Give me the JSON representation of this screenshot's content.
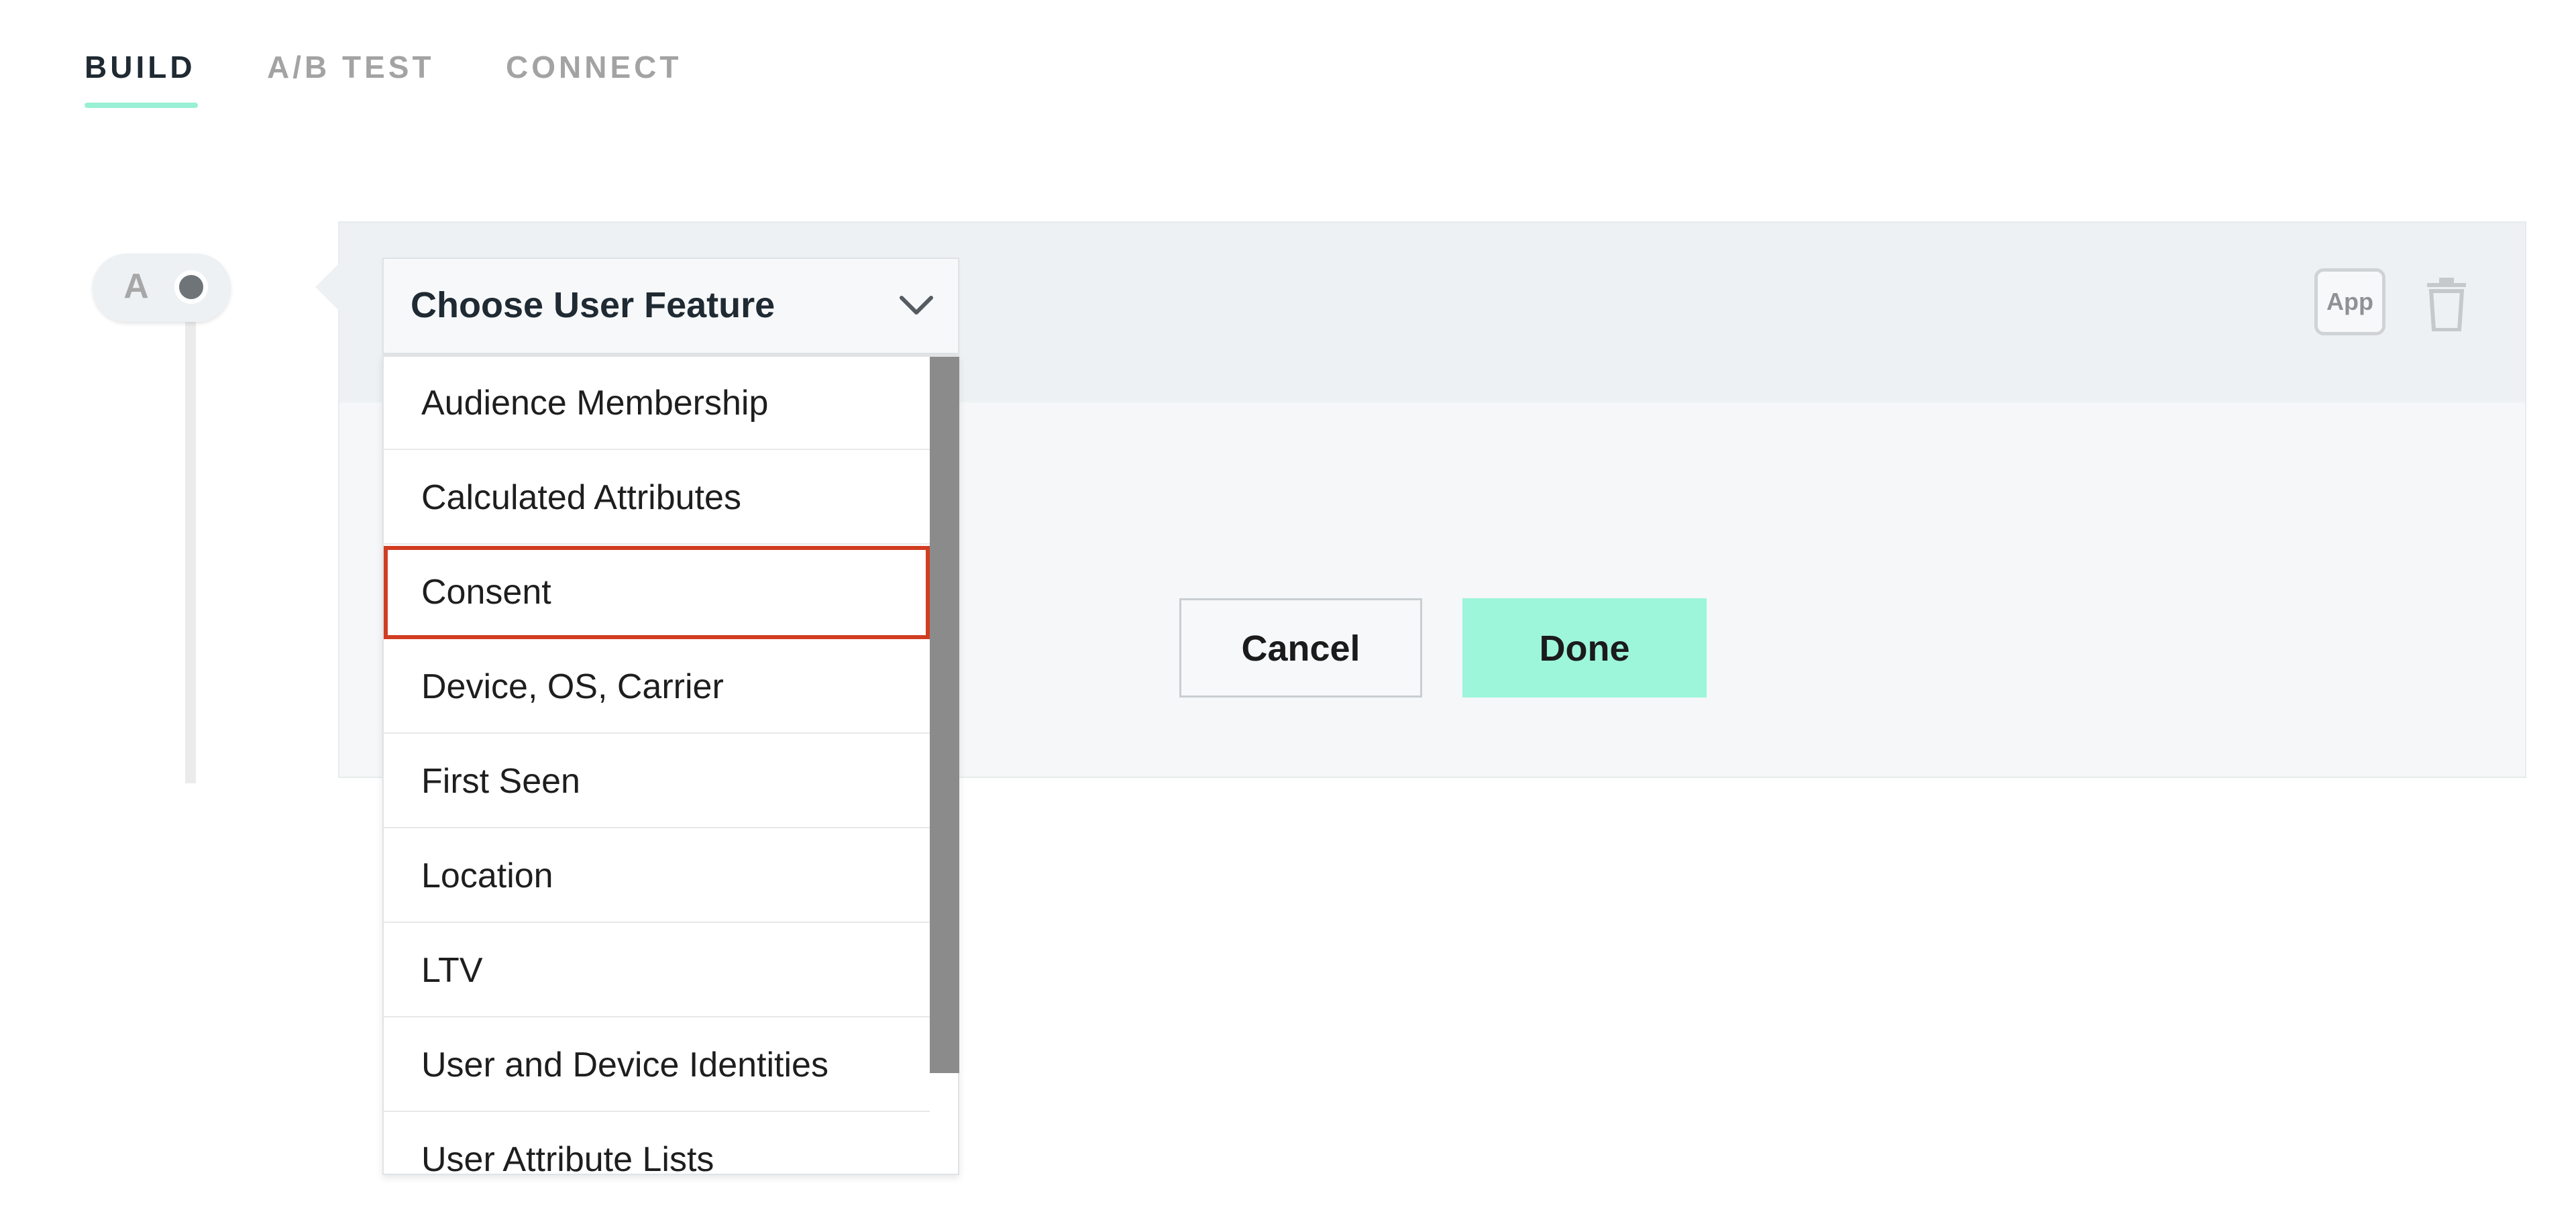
{
  "tabs": [
    {
      "label": "BUILD",
      "active": true
    },
    {
      "label": "A/B TEST",
      "active": false
    },
    {
      "label": "CONNECT",
      "active": false
    }
  ],
  "variant": {
    "letter": "A"
  },
  "card": {
    "app_label": "App",
    "delete_icon": "trash-icon"
  },
  "dropdown": {
    "selected_label": "Choose User Feature",
    "items": [
      {
        "label": "Audience Membership"
      },
      {
        "label": "Calculated Attributes"
      },
      {
        "label": "Consent",
        "highlighted": true
      },
      {
        "label": "Device, OS, Carrier"
      },
      {
        "label": "First Seen"
      },
      {
        "label": "Location"
      },
      {
        "label": "LTV"
      },
      {
        "label": "User and Device Identities"
      },
      {
        "label": "User Attribute Lists"
      }
    ]
  },
  "actions": {
    "cancel_label": "Cancel",
    "done_label": "Done"
  },
  "colors": {
    "accent": "#99f0d4",
    "done_button": "#9df5da",
    "highlight_outline": "#d13d22"
  }
}
